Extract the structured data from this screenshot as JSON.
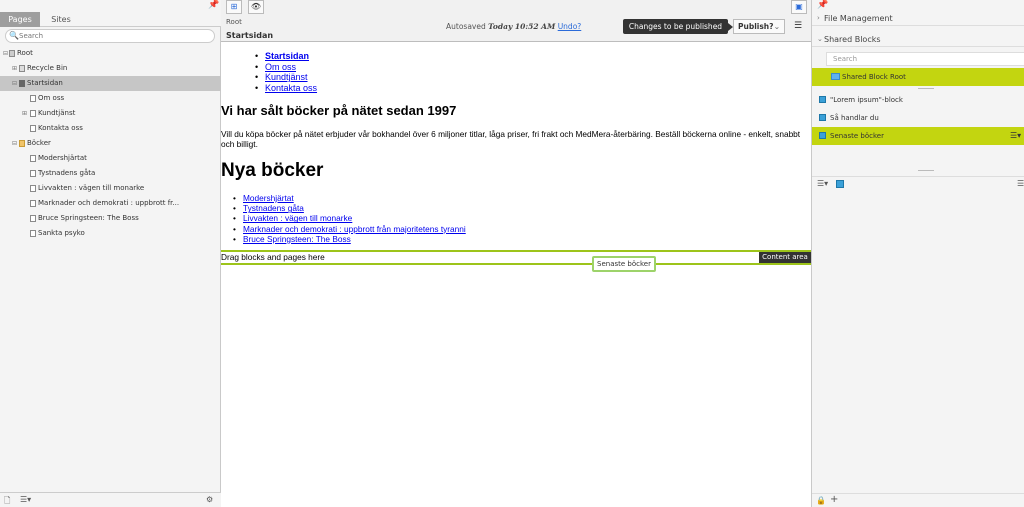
{
  "left": {
    "tabs": [
      "Pages",
      "Sites"
    ],
    "search_placeholder": "Search",
    "tree": [
      {
        "label": "Root",
        "icon": "root-icon",
        "toggle": "⊟"
      },
      {
        "label": "Recycle Bin",
        "icon": "trash-icon",
        "toggle": "⊞"
      },
      {
        "label": "Startsidan",
        "icon": "home-icon",
        "toggle": "⊟",
        "selected": true
      },
      {
        "label": "Om oss",
        "icon": "page-icon"
      },
      {
        "label": "Kundtjänst",
        "icon": "page-icon",
        "toggle": "⊞"
      },
      {
        "label": "Kontakta oss",
        "icon": "page-icon"
      },
      {
        "label": "Böcker",
        "icon": "folder-icon",
        "toggle": "⊟"
      },
      {
        "label": "Modershjärtat",
        "icon": "page-icon"
      },
      {
        "label": "Tystnadens gåta",
        "icon": "page-icon"
      },
      {
        "label": "Livvakten : vägen till monarke",
        "icon": "page-icon"
      },
      {
        "label": "Marknader och demokrati : uppbrott fr...",
        "icon": "page-icon"
      },
      {
        "label": "Bruce Springsteen: The Boss",
        "icon": "page-icon"
      },
      {
        "label": "Sankta psyko",
        "icon": "page-icon"
      }
    ]
  },
  "header": {
    "breadcrumb": "Root",
    "page_title": "Startsidan",
    "autosaved_label": "Autosaved",
    "autosaved_time": "Today 10:52 AM",
    "undo_label": "Undo?",
    "changes_label": "Changes to be published",
    "publish_label": "Publish?"
  },
  "content": {
    "nav_links": [
      "Startsidan",
      "Om oss",
      "Kundtjänst",
      "Kontakta oss"
    ],
    "heading": "Vi har sålt böcker på nätet sedan 1997",
    "paragraph": "Vill du köpa böcker på nätet erbjuder vår bokhandel över 6 miljoner titlar, låga priser, fri frakt och MedMera-återbäring. Beställ böckerna online - enkelt, snabbt och billigt.",
    "new_books_title": "Nya böcker",
    "book_links": [
      "Modershjärtat",
      "Tystnadens gåta",
      "Livvakten : vägen till monarke",
      "Marknader och demokrati : uppbrott från majoritetens tyranni",
      "Bruce Springsteen: The Boss"
    ],
    "drop_text": "Drag blocks and pages here",
    "content_area_label": "Content area",
    "drag_tooltip": "Senaste böcker"
  },
  "right": {
    "file_management": "File Management",
    "shared_blocks": "Shared Blocks",
    "search_placeholder": "Search",
    "root_folder": "Shared Block Root",
    "blocks": [
      {
        "label": "\"Lorem ipsum\"-block"
      },
      {
        "label": "Så handlar du"
      },
      {
        "label": "Senaste böcker",
        "selected": true
      }
    ]
  },
  "colors": {
    "accent_green": "#c3d510",
    "selection_gray": "#c6c6c6",
    "link_blue": "#0000ee"
  }
}
